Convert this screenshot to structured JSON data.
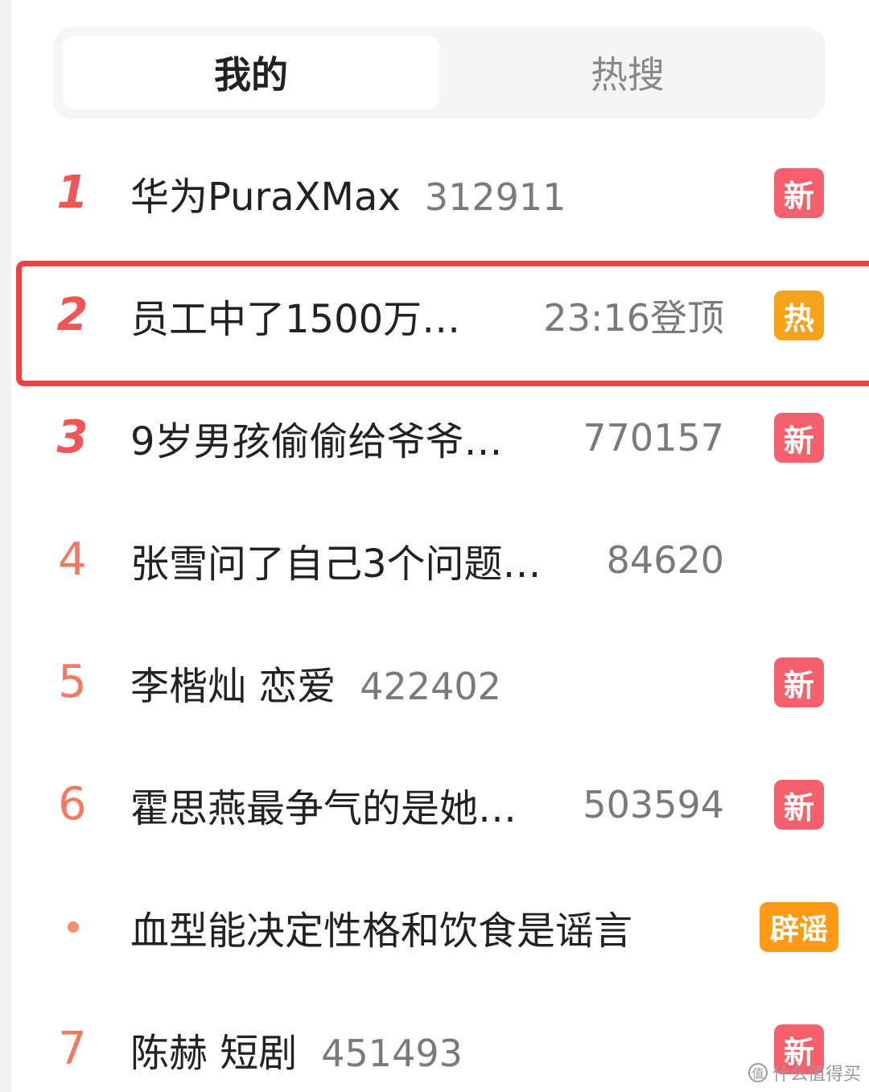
{
  "tabs": [
    {
      "label": "我的",
      "active": true
    },
    {
      "label": "热搜",
      "active": false
    }
  ],
  "items": [
    {
      "rank": "1",
      "topic": "华为PuraXMax",
      "metric": "312911",
      "badge": "新"
    },
    {
      "rank": "2",
      "topic": "员工中了1500万…",
      "metric": "23:16登顶",
      "badge": "热"
    },
    {
      "rank": "3",
      "topic": "9岁男孩偷偷给爷爷…",
      "metric": "770157",
      "badge": "新"
    },
    {
      "rank": "4",
      "topic": "张雪问了自己3个问题…",
      "metric": "84620",
      "badge": ""
    },
    {
      "rank": "5",
      "topic": "李楷灿 恋爱",
      "metric": "422402",
      "badge": "新"
    },
    {
      "rank": "6",
      "topic": "霍思燕最争气的是她…",
      "metric": "503594",
      "badge": "新"
    },
    {
      "rank": "",
      "topic": "血型能决定性格和饮食是谣言",
      "metric": "",
      "badge": "辟谣"
    },
    {
      "rank": "7",
      "topic": "陈赫 短剧",
      "metric": "451493",
      "badge": "新"
    }
  ],
  "watermark": {
    "text": "什么值得买",
    "icon_glyph": "值"
  },
  "colors": {
    "rank_top": "#f25555",
    "rank_normal": "#f07a62",
    "badge_new": "#f5606c",
    "badge_hot": "#f7a21b",
    "badge_rumor": "#ff9a16",
    "highlight_border": "#f24040"
  }
}
